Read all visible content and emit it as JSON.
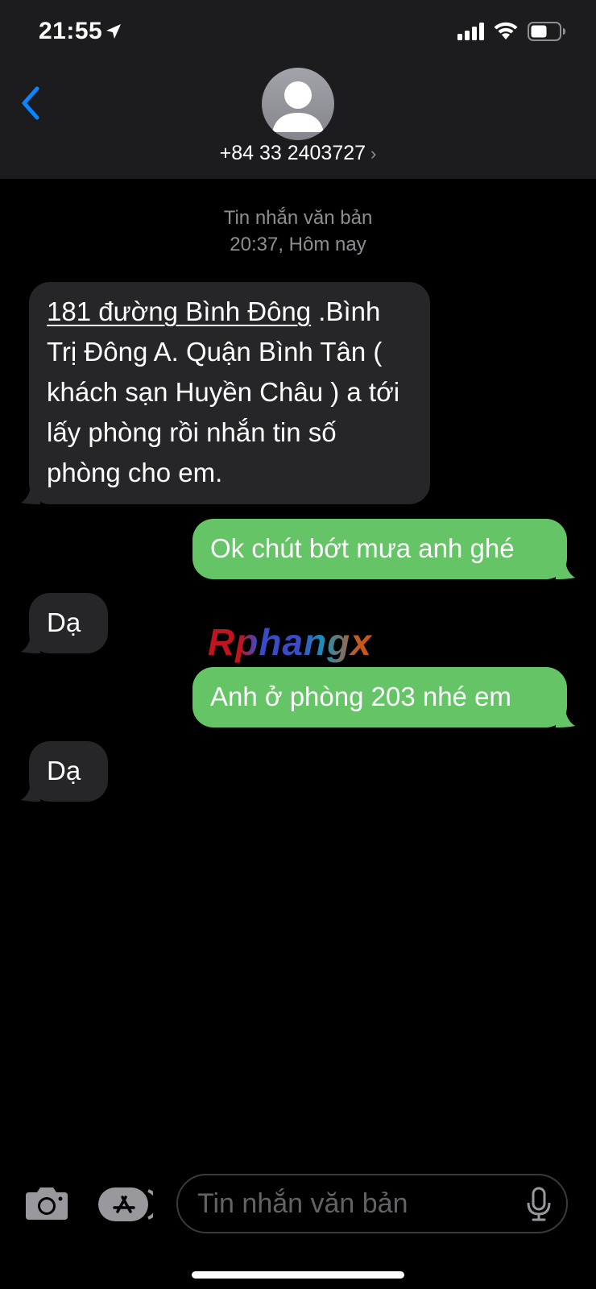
{
  "status_bar": {
    "time": "21:55"
  },
  "header": {
    "contact": "+84 33 2403727",
    "chevron": "›"
  },
  "timestamp": {
    "line1": "Tin nhắn văn bản",
    "line2": "20:37, Hôm nay"
  },
  "messages": [
    {
      "type": "received",
      "address_link": "181 đường Bình Đông",
      "text_rest": " .Bình Trị Đông A. Quận Bình Tân ( khách sạn Huyền Châu ) a tới lấy phòng rồi nhắn tin số phòng cho em."
    },
    {
      "type": "sent",
      "text": "Ok chút bớt mưa anh ghé"
    },
    {
      "type": "received",
      "text": "Dạ"
    },
    {
      "type": "sent",
      "text": "Anh ở phòng 203 nhé em"
    },
    {
      "type": "received",
      "text": "Dạ"
    }
  ],
  "watermark": "Rphangx",
  "compose": {
    "placeholder": "Tin nhắn văn bản",
    "value": ""
  },
  "colors": {
    "sent_bubble": "#65c466",
    "received_bubble": "#262628",
    "accent": "#0a84ff",
    "header_bg": "#1c1c1e"
  },
  "icons": [
    "location-arrow-icon",
    "signal-icon",
    "wifi-icon",
    "battery-icon",
    "back-chevron-icon",
    "contact-avatar-icon",
    "camera-icon",
    "app-store-icon",
    "microphone-icon"
  ]
}
